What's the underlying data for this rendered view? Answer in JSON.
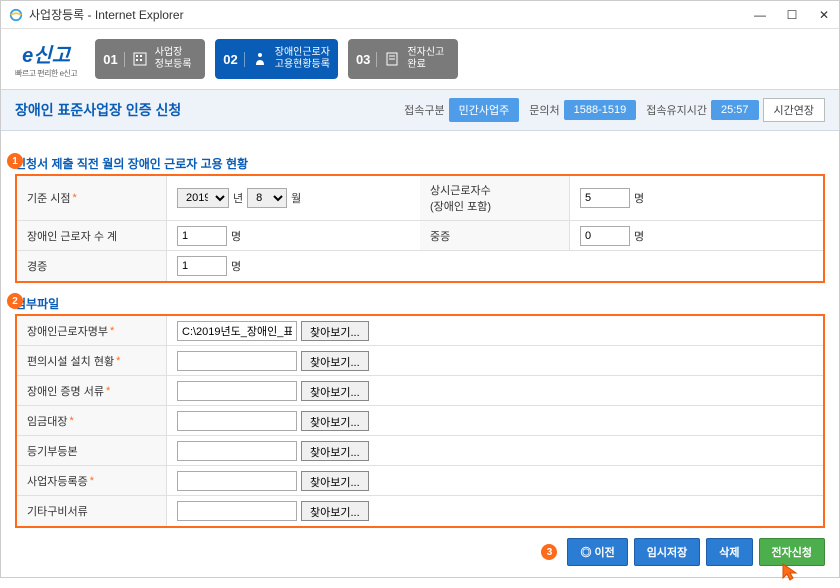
{
  "window": {
    "title": "사업장등록 - Internet Explorer"
  },
  "logo": {
    "main": "신고",
    "prefix": "e",
    "sub": "빠르고 편리한 e신고"
  },
  "steps": [
    {
      "num": "01",
      "label": "사업장\n정보등록"
    },
    {
      "num": "02",
      "label": "장애인근로자\n고용현황등록"
    },
    {
      "num": "03",
      "label": "전자신고\n완료"
    }
  ],
  "page_title": "장애인 표준사업장 인증 신청",
  "status": {
    "access_label": "접속구분",
    "access_value": "민간사업주",
    "contact_label": "문의처",
    "contact_value": "1588-1519",
    "session_label": "접속유지시간",
    "session_value": "25:57",
    "extend_btn": "시간연장"
  },
  "section1": {
    "badge": "1",
    "title": "신청서 제출 직전 월의 장애인 근로자 고용 현황",
    "base_label": "기준 시점",
    "year_value": "2019",
    "year_unit": "년",
    "month_value": "8",
    "month_unit": "월",
    "regular_label": "상시근로자수\n(장애인 포함)",
    "regular_value": "5",
    "person_unit": "명",
    "disabled_total_label": "장애인 근로자 수 계",
    "disabled_total_value": "1",
    "joongjeung_label": "중증",
    "joongjeung_value": "0",
    "gyeongjeung_label": "경증",
    "gyeongjeung_value": "1"
  },
  "section2": {
    "badge": "2",
    "title": "첨부파일",
    "items": [
      {
        "label": "장애인근로자명부",
        "required": true,
        "value": "C:\\2019년도_장애인_표"
      },
      {
        "label": "편의시설 설치 현황",
        "required": true,
        "value": ""
      },
      {
        "label": "장애인 증명 서류",
        "required": true,
        "value": ""
      },
      {
        "label": "임금대장",
        "required": true,
        "value": ""
      },
      {
        "label": "등기부등본",
        "required": false,
        "value": ""
      },
      {
        "label": "사업자등록증",
        "required": true,
        "value": ""
      },
      {
        "label": "기타구비서류",
        "required": false,
        "value": ""
      }
    ],
    "browse_btn": "찾아보기..."
  },
  "actions": {
    "badge": "3",
    "prev": "이전",
    "temp_save": "임시저장",
    "delete": "삭제",
    "submit": "전자신청"
  }
}
